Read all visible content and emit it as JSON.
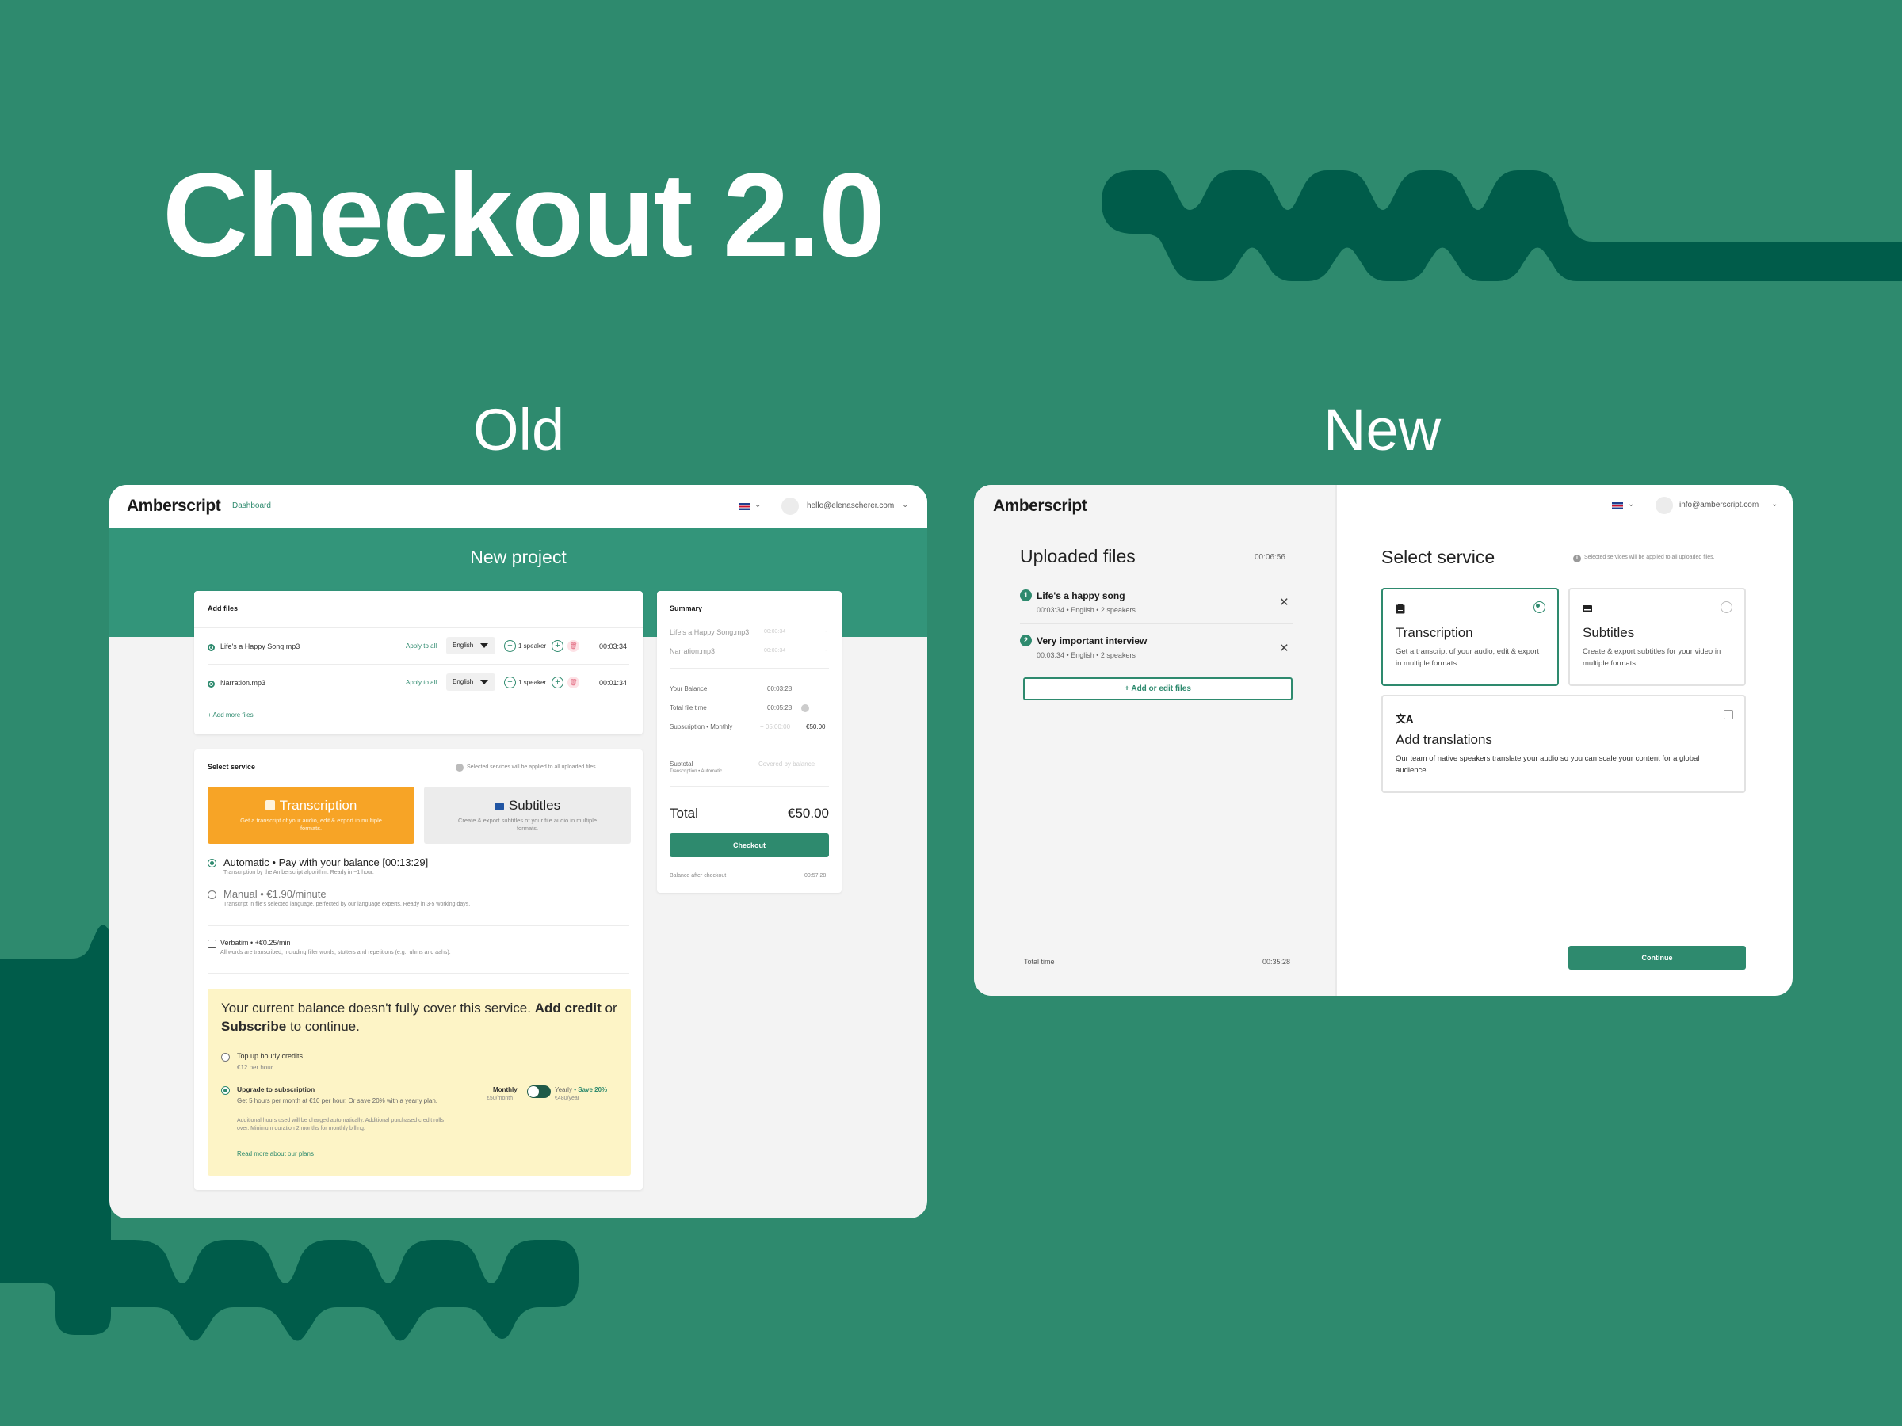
{
  "hero": {
    "title": "Checkout 2.0",
    "old_label": "Old",
    "new_label": "New"
  },
  "colors": {
    "background": "#2e8a6e",
    "wave": "#005c4a",
    "accent": "#2e8a6e",
    "orange": "#f7a426",
    "notice": "#fdf4c6"
  },
  "old": {
    "logo": "Amberscript",
    "nav": "Dashboard",
    "email": "hello@elenascherer.com",
    "banner_title": "New project",
    "add_files": {
      "title": "Add files",
      "files": [
        {
          "name": "Life's a Happy Song.mp3",
          "apply": "Apply to all",
          "language": "English",
          "speakers": "1 speaker",
          "duration": "00:03:34"
        },
        {
          "name": "Narration.mp3",
          "apply": "Apply to all",
          "language": "English",
          "speakers": "1 speaker",
          "duration": "00:01:34"
        }
      ],
      "add_more": "+ Add more files"
    },
    "service": {
      "title": "Select service",
      "note": "Selected services will be applied to all uploaded files.",
      "transcription": {
        "label": "Transcription",
        "desc": "Get a transcript of your audio, edit & export in multiple formats."
      },
      "subtitles": {
        "label": "Subtitles",
        "desc": "Create & export subtitles of your file audio in multiple formats."
      },
      "automatic": {
        "title": "Automatic • Pay with your balance [00:13:29]",
        "desc": "Transcription by the Amberscript algorithm. Ready in ~1 hour."
      },
      "manual": {
        "title": "Manual • €1.90/minute",
        "desc": "Transcript in file's selected language, perfected by our language experts. Ready in 3-5 working days."
      },
      "verbatim": {
        "title": "Verbatim • +€0.25/min",
        "desc": "All words are transcribed, including filler words, stutters and repetitions (e.g.: uhms and aahs)."
      }
    },
    "notice": {
      "pre": "Your current balance doesn't fully cover this service.",
      "add_credit": "Add credit",
      "or": "or",
      "subscribe": "Subscribe",
      "post": "to continue.",
      "top_up": {
        "title": "Top up hourly credits",
        "price": "€12 per hour"
      },
      "upgrade": {
        "title": "Upgrade to subscription",
        "desc": "Get 5 hours per month at €10 per hour. Or save 20% with a yearly plan.",
        "fine": "Additional hours used will be charged automatically. Additional purchased credit rolls over. Minimum duration 2 months for monthly billing.",
        "link": "Read more about our plans",
        "monthly": "Monthly",
        "monthly_price": "€50/month",
        "yearly": "Yearly",
        "save": "• Save 20%",
        "yearly_price": "€480/year"
      }
    },
    "summary": {
      "title": "Summary",
      "items": [
        {
          "name": "Life's a Happy Song.mp3",
          "time": "00:03:34",
          "price": "-"
        },
        {
          "name": "Narration.mp3",
          "time": "00:03:34",
          "price": "-"
        }
      ],
      "balance_label": "Your Balance",
      "balance": "00:03:28",
      "file_time_label": "Total file time",
      "file_time": "00:05:28",
      "subscription_label": "Subscription • Monthly",
      "subscription_time": "+ 05:00:00",
      "subscription_price": "€50.00",
      "subtotal_label": "Subtotal",
      "subtotal_sub": "Transcription • Automatic",
      "subtotal_value": "Covered by balance",
      "total_label": "Total",
      "total": "€50.00",
      "checkout": "Checkout",
      "after_label": "Balance after checkout",
      "after": "00:57:28"
    }
  },
  "new": {
    "logo": "Amberscript",
    "email": "info@amberscript.com",
    "uploaded": {
      "title": "Uploaded files",
      "total": "00:06:56",
      "files": [
        {
          "num": "1",
          "name": "Life's a happy song",
          "meta": "00:03:34  •  English  •  2 speakers"
        },
        {
          "num": "2",
          "name": "Very important interview",
          "meta": "00:03:34  •  English  •  2 speakers"
        }
      ],
      "add_button": "+ Add or edit files",
      "total_time_label": "Total time",
      "total_time": "00:35:28"
    },
    "service": {
      "title": "Select service",
      "note": "Selected services will be applied to all uploaded files.",
      "transcription": {
        "label": "Transcription",
        "desc": "Get a transcript of your audio, edit & export in multiple formats."
      },
      "subtitles": {
        "label": "Subtitles",
        "desc": "Create & export subtitles for your video in multiple formats."
      },
      "translations": {
        "label": "Add translations",
        "desc": "Our team of native speakers translate your audio so you can scale your content for a global audience."
      },
      "continue": "Continue"
    }
  }
}
